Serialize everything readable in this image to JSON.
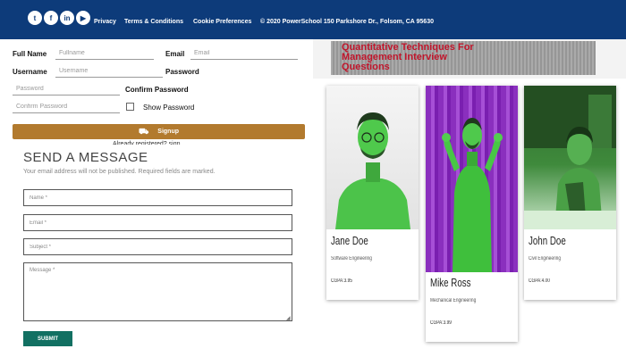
{
  "footer": {
    "social": [
      {
        "icon": "twitter-icon",
        "glyph": "t"
      },
      {
        "icon": "facebook-icon",
        "glyph": "f"
      },
      {
        "icon": "linkedin-icon",
        "glyph": "in"
      },
      {
        "icon": "youtube-icon",
        "glyph": "▶"
      }
    ],
    "links": [
      "Privacy",
      "Terms & Conditions",
      "Cookie Preferences"
    ],
    "copyright": "© 2020 PowerSchool 150 Parkshore Dr., Folsom, CA 95630",
    "background": "#0d3b7a"
  },
  "signup": {
    "fullname_label": "Full Name",
    "fullname_placeholder": "Fullname",
    "email_label": "Email",
    "email_placeholder": "Email",
    "username_label": "Username",
    "username_placeholder": "Username",
    "password_label": "Password",
    "password_placeholder": "Password",
    "confirm_label": "Confirm Password",
    "confirm_placeholder": "Confirm Password",
    "show_password_label": "Show Password",
    "signup_label": "Signup",
    "already_text": "Already registered? sign",
    "button_color": "#b27a2e"
  },
  "contact": {
    "title": "SEND A MESSAGE",
    "subtitle": "Your email address will not be published. Required fields are marked.",
    "name_placeholder": "Name *",
    "email_placeholder": "Email *",
    "subject_placeholder": "Subject *",
    "message_placeholder": "Message *",
    "submit_label": "SUBMIT",
    "submit_color": "#127062"
  },
  "banner": {
    "lines": [
      "Quantitative Techniques For",
      "Management Interview",
      "Questions"
    ],
    "text_color": "#c0152b"
  },
  "cards": [
    {
      "name": "Jane Doe",
      "major": "Software Engineering",
      "gpa": "CGPA:3.95"
    },
    {
      "name": "Mike Ross",
      "major": "Mechanical Engineering",
      "gpa": "CGPA:3.99"
    },
    {
      "name": "John Doe",
      "major": "Civil Engineering",
      "gpa": "CGPA:4.00"
    }
  ]
}
